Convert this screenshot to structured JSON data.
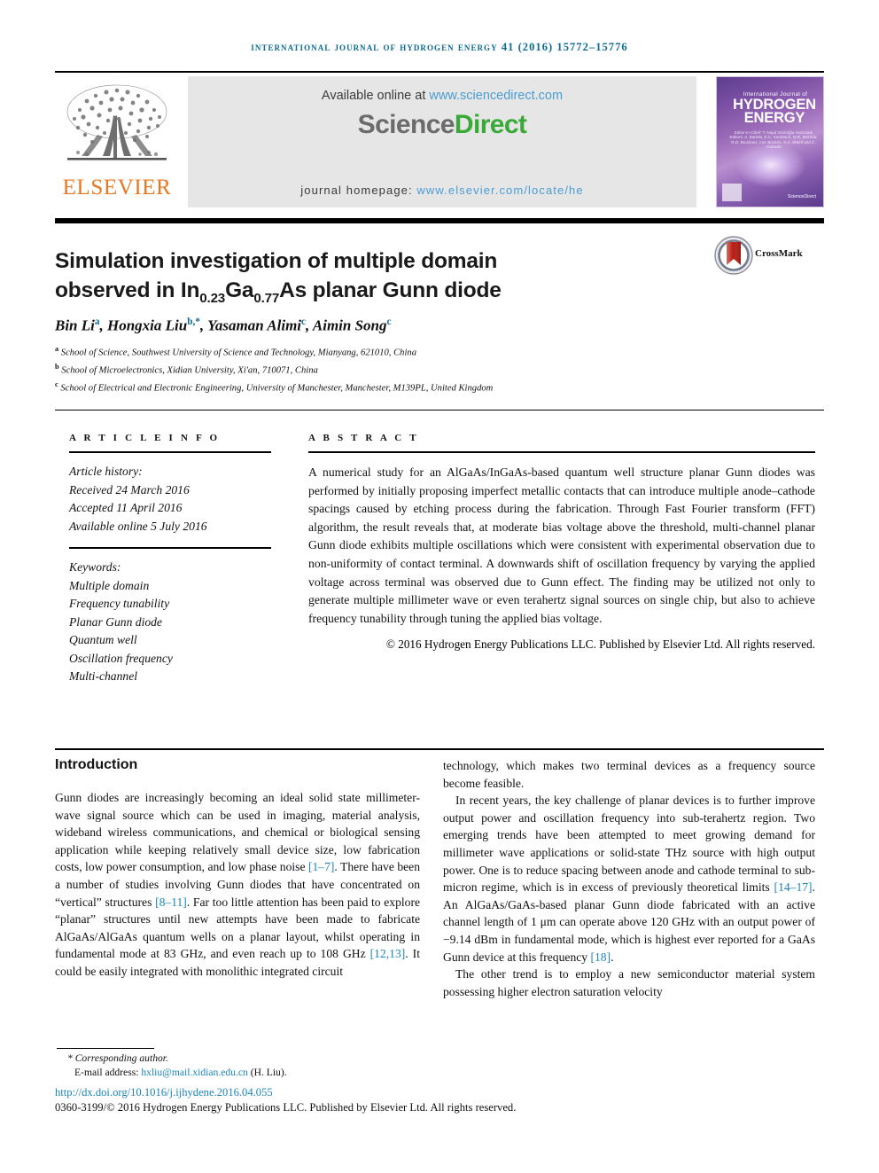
{
  "running_head": "International Journal of Hydrogen Energy 41 (2016) 15772–15776",
  "masthead": {
    "publisher_name": "ELSEVIER",
    "available_prefix": "Available online at ",
    "available_url": "www.sciencedirect.com",
    "sciencedirect_part1": "Science",
    "sciencedirect_part2": "Direct",
    "homepage_prefix": "journal homepage: ",
    "homepage_url": "www.elsevier.com/locate/he",
    "cover": {
      "line_small": "International Journal of",
      "line_big_1": "HYDROGEN",
      "line_big_2": "ENERGY",
      "editors": "Editor-in-Chief: T. Nejat Veziroğlu    Associate Editors: A. Bartels, E.C. Kordesch, M.R. Meréda, R.D. Bruckner, J.M. Bockris, S.A. Sherif and C. Andrade",
      "sciencedirect_mark": "ScienceDirect"
    }
  },
  "article": {
    "title_line1": "Simulation investigation of multiple domain",
    "title_line2_pre": "observed in In",
    "title_sub1": "0.23",
    "title_mid": "Ga",
    "title_sub2": "0.77",
    "title_post": "As planar Gunn diode",
    "crossmark_label": "CrossMark",
    "authors": [
      {
        "name": "Bin Li",
        "marks": "a"
      },
      {
        "name": "Hongxia Liu",
        "marks": "b,*"
      },
      {
        "name": "Yasaman Alimi",
        "marks": "c"
      },
      {
        "name": "Aimin Song",
        "marks": "c"
      }
    ],
    "affiliations": [
      {
        "mark": "a",
        "text": "School of Science, Southwest University of Science and Technology, Mianyang, 621010, China"
      },
      {
        "mark": "b",
        "text": "School of Microelectronics, Xidian University, Xi'an, 710071, China"
      },
      {
        "mark": "c",
        "text": "School of Electrical and Electronic Engineering, University of Manchester, Manchester, M139PL, United Kingdom"
      }
    ]
  },
  "article_info": {
    "heading": "A R T I C L E  I N F O",
    "history_label": "Article history:",
    "received": "Received 24 March 2016",
    "accepted": "Accepted 11 April 2016",
    "available_online": "Available online 5 July 2016",
    "keywords_label": "Keywords:",
    "keywords": [
      "Multiple domain",
      "Frequency tunability",
      "Planar Gunn diode",
      "Quantum well",
      "Oscillation frequency",
      "Multi-channel"
    ]
  },
  "abstract": {
    "heading": "A B S T R A C T",
    "text": "A numerical study for an AlGaAs/InGaAs-based quantum well structure planar Gunn diodes was performed by initially proposing imperfect metallic contacts that can introduce multiple anode–cathode spacings caused by etching process during the fabrication. Through Fast Fourier transform (FFT) algorithm, the result reveals that, at moderate bias voltage above the threshold, multi-channel planar Gunn diode exhibits multiple oscillations which were consistent with experimental observation due to non-uniformity of contact terminal. A downwards shift of oscillation frequency by varying the applied voltage across terminal was observed due to Gunn effect. The finding may be utilized not only to generate multiple millimeter wave or even terahertz signal sources on single chip, but also to achieve frequency tunability through tuning the applied bias voltage.",
    "copyright": "© 2016 Hydrogen Energy Publications LLC. Published by Elsevier Ltd. All rights reserved."
  },
  "body": {
    "section_title": "Introduction",
    "left_paragraph_1_a": "Gunn diodes are increasingly becoming an ideal solid state millimeter-wave signal source which can be used in imaging, material analysis, wideband wireless communications, and chemical or biological sensing application while keeping relatively small device size, low fabrication costs, low power consumption, and low phase noise ",
    "ref_1_7": "[1–7]",
    "left_paragraph_1_b": ". There have been a number of studies involving Gunn diodes that have concentrated on “vertical” structures ",
    "ref_8_11": "[8–11]",
    "left_paragraph_1_c": ". Far too little attention has been paid to explore “planar” structures until new attempts have been made to fabricate AlGaAs/AlGaAs quantum wells on a planar layout, whilst operating in fundamental mode at 83 GHz, and even reach up to 108 GHz ",
    "ref_12_13": "[12,13]",
    "left_paragraph_1_d": ". It could be easily integrated with monolithic integrated circuit",
    "right_paragraph_1": "technology, which makes two terminal devices as a frequency source become feasible.",
    "right_paragraph_2_a": "In recent years, the key challenge of planar devices is to further improve output power and oscillation frequency into sub-terahertz region. Two emerging trends have been attempted to meet growing demand for millimeter wave applications or solid-state THz source with high output power. One is to reduce spacing between anode and cathode terminal to sub-micron regime, which is in excess of previously theoretical limits ",
    "ref_14_17": "[14–17]",
    "right_paragraph_2_b": ". An AlGaAs/GaAs-based planar Gunn diode fabricated with an active channel length of 1 μm can operate above 120 GHz with an output power of −9.14 dBm in fundamental mode, which is highest ever reported for a GaAs Gunn device at this frequency ",
    "ref_18": "[18]",
    "right_paragraph_2_c": ".",
    "right_paragraph_3": "The other trend is to employ a new semiconductor material system possessing higher electron saturation velocity"
  },
  "footer": {
    "corresponding_author": "* Corresponding author.",
    "email_label": "E-mail address: ",
    "email": "hxliu@mail.xidian.edu.cn",
    "email_suffix": " (H. Liu).",
    "doi": "http://dx.doi.org/10.1016/j.ijhydene.2016.04.055",
    "issn_line": "0360-3199/© 2016 Hydrogen Energy Publications LLC. Published by Elsevier Ltd. All rights reserved."
  },
  "colors": {
    "link_blue": "#1b84b8",
    "running_head_blue": "#0b6a96",
    "elsevier_orange": "#E87722",
    "sciencedirect_green": "#3aa93a",
    "banner_gray": "#e6e6e6"
  }
}
